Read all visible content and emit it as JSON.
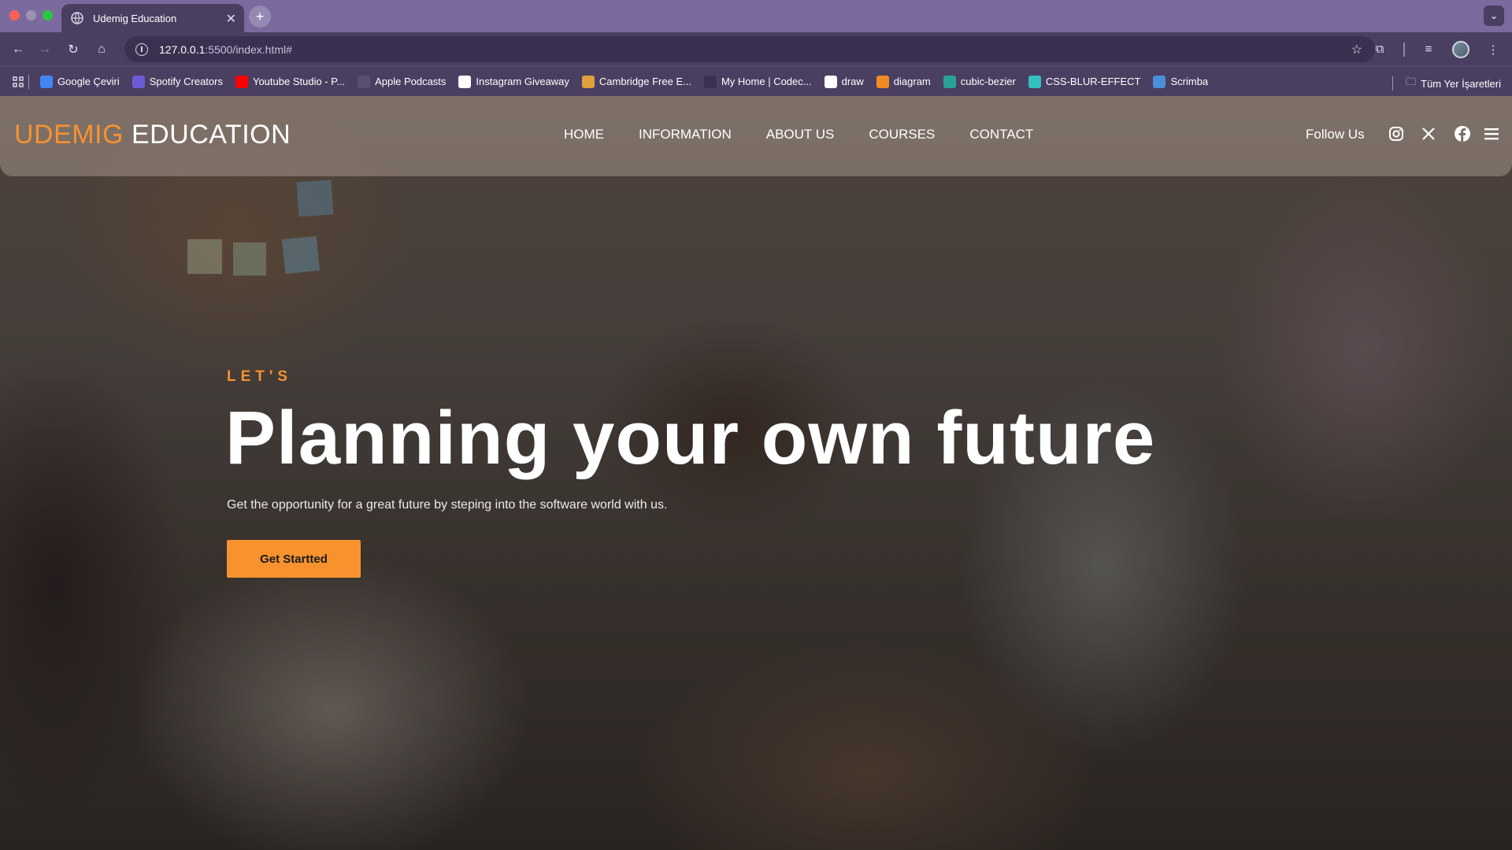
{
  "browser": {
    "tab_title": "Udemig Education",
    "url_host": "127.0.0.1",
    "url_path": ":5500/index.html#",
    "bookmarks": [
      {
        "label": "Google Çeviri",
        "color": "#4285f4"
      },
      {
        "label": "Spotify Creators",
        "color": "#6b5bd6"
      },
      {
        "label": "Youtube Studio - P...",
        "color": "#ff0000"
      },
      {
        "label": "Apple Podcasts",
        "color": "#5a4f72"
      },
      {
        "label": "Instagram Giveaway",
        "color": "#ffffff"
      },
      {
        "label": "Cambridge Free E...",
        "color": "#e0a040"
      },
      {
        "label": "My Home | Codec...",
        "color": "#3a304f"
      },
      {
        "label": "draw",
        "color": "#ffffff"
      },
      {
        "label": "diagram",
        "color": "#f08a24"
      },
      {
        "label": "cubic-bezier",
        "color": "#2aa198"
      },
      {
        "label": "CSS-BLUR-EFFECT",
        "color": "#35c0c0"
      },
      {
        "label": "Scrimba",
        "color": "#4a90d9"
      }
    ],
    "all_bookmarks_label": "Tüm Yer İşaretleri"
  },
  "site": {
    "logo_part1": "UDEMIG",
    "logo_part2": "EDUCATION",
    "nav": [
      "HOME",
      "INFORMATION",
      "ABOUT US",
      "COURSES",
      "CONTACT"
    ],
    "follow_label": "Follow Us",
    "social_icons": [
      "instagram-icon",
      "x-icon",
      "facebook-icon"
    ],
    "menu_icon": "hamburger-menu-icon"
  },
  "hero": {
    "eyebrow": "LET'S",
    "headline": "Planning your own future",
    "subline": "Get the opportunity for a great future by steping into the software world with us.",
    "cta_label": "Get Startted"
  },
  "colors": {
    "accent": "#f7922e",
    "browser_chrome": "#4a3f61",
    "tabstrip": "#7b6a9e"
  }
}
